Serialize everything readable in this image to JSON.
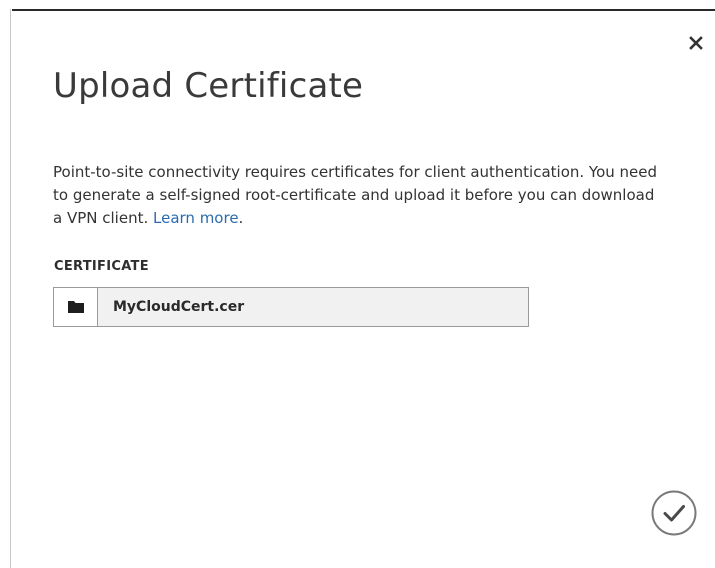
{
  "dialog": {
    "title": "Upload Certificate",
    "description_text": "Point-to-site connectivity requires certificates for client authentication. You need to generate a self-signed root-certificate and upload it before you can download a VPN client. ",
    "learn_more_link": "Learn more",
    "description_end": "."
  },
  "certificate_field": {
    "label": "CERTIFICATE",
    "value": "MyCloudCert.cer",
    "browse_icon": "folder-icon"
  },
  "actions": {
    "close_icon": "close-icon",
    "confirm_icon": "checkmark-circle-icon"
  },
  "colors": {
    "link": "#2b6cb0",
    "text": "#333333",
    "field_background": "#f1f1f1",
    "field_border": "#9a9a9a"
  }
}
